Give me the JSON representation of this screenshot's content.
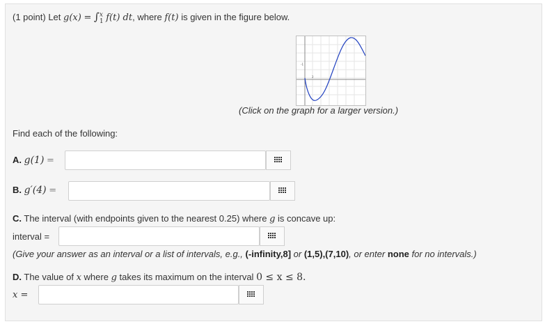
{
  "problem": {
    "points": "(1 point)",
    "intro_let": "Let",
    "gx": "g(x)",
    "eq": "=",
    "integral": "∫",
    "upper": "x",
    "lower": "1",
    "integrand": "f(t) dt",
    "where_text": ", where",
    "ft": "f(t)",
    "rest_text": "is given in the figure below."
  },
  "graph": {
    "caption": "(Click on the graph for a larger version.)",
    "curve_color": "#1f3fbf",
    "tick_label_y": "-1",
    "tick_label_x": "2"
  },
  "find_each": "Find each of the following:",
  "part_a": {
    "letter": "A.",
    "expr": "g(1)",
    "eq": "="
  },
  "part_b": {
    "letter": "B.",
    "expr": "g′(4)",
    "eq": "="
  },
  "part_c": {
    "letter": "C.",
    "text_before": "The interval (with endpoints given to the nearest 0.25) where",
    "g": "g",
    "text_after": "is concave up:",
    "interval_label": "interval =",
    "hint_prefix": "(Give your answer as an interval or a list of intervals, e.g.,",
    "ex1": "(-infinity,8]",
    "or1": "or",
    "ex2": "(1,5),(7,10)",
    "hint_mid": ", or enter",
    "ex3": "none",
    "hint_suffix": "for no intervals.)"
  },
  "part_d": {
    "letter": "D.",
    "text_before": "The value of",
    "x": "x",
    "text_mid": "where",
    "g": "g",
    "text_after": "takes its maximum on the interval",
    "range": "0 ≤ x ≤ 8.",
    "answer_label": "x =",
    "eq_sign": "="
  },
  "keyboard_icon_name": "keyboard-grid-icon"
}
